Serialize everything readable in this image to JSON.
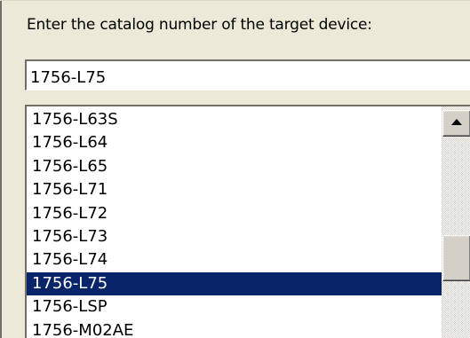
{
  "prompt": {
    "label": "Enter the catalog number of the target device:"
  },
  "catalog_input": {
    "value": "1756-L75"
  },
  "device_list": {
    "items": [
      "1756-L63S",
      "1756-L64",
      "1756-L65",
      "1756-L71",
      "1756-L72",
      "1756-L73",
      "1756-L74",
      "1756-L75",
      "1756-LSP",
      "1756-M02AE"
    ],
    "selected": "1756-L75"
  },
  "scrollbar": {
    "up_icon": "scroll-up-arrow",
    "position_fraction": 0.55
  },
  "colors": {
    "selection_background": "#0a246a",
    "selection_text": "#ffffff",
    "dialog_background": "#ece9d8"
  }
}
